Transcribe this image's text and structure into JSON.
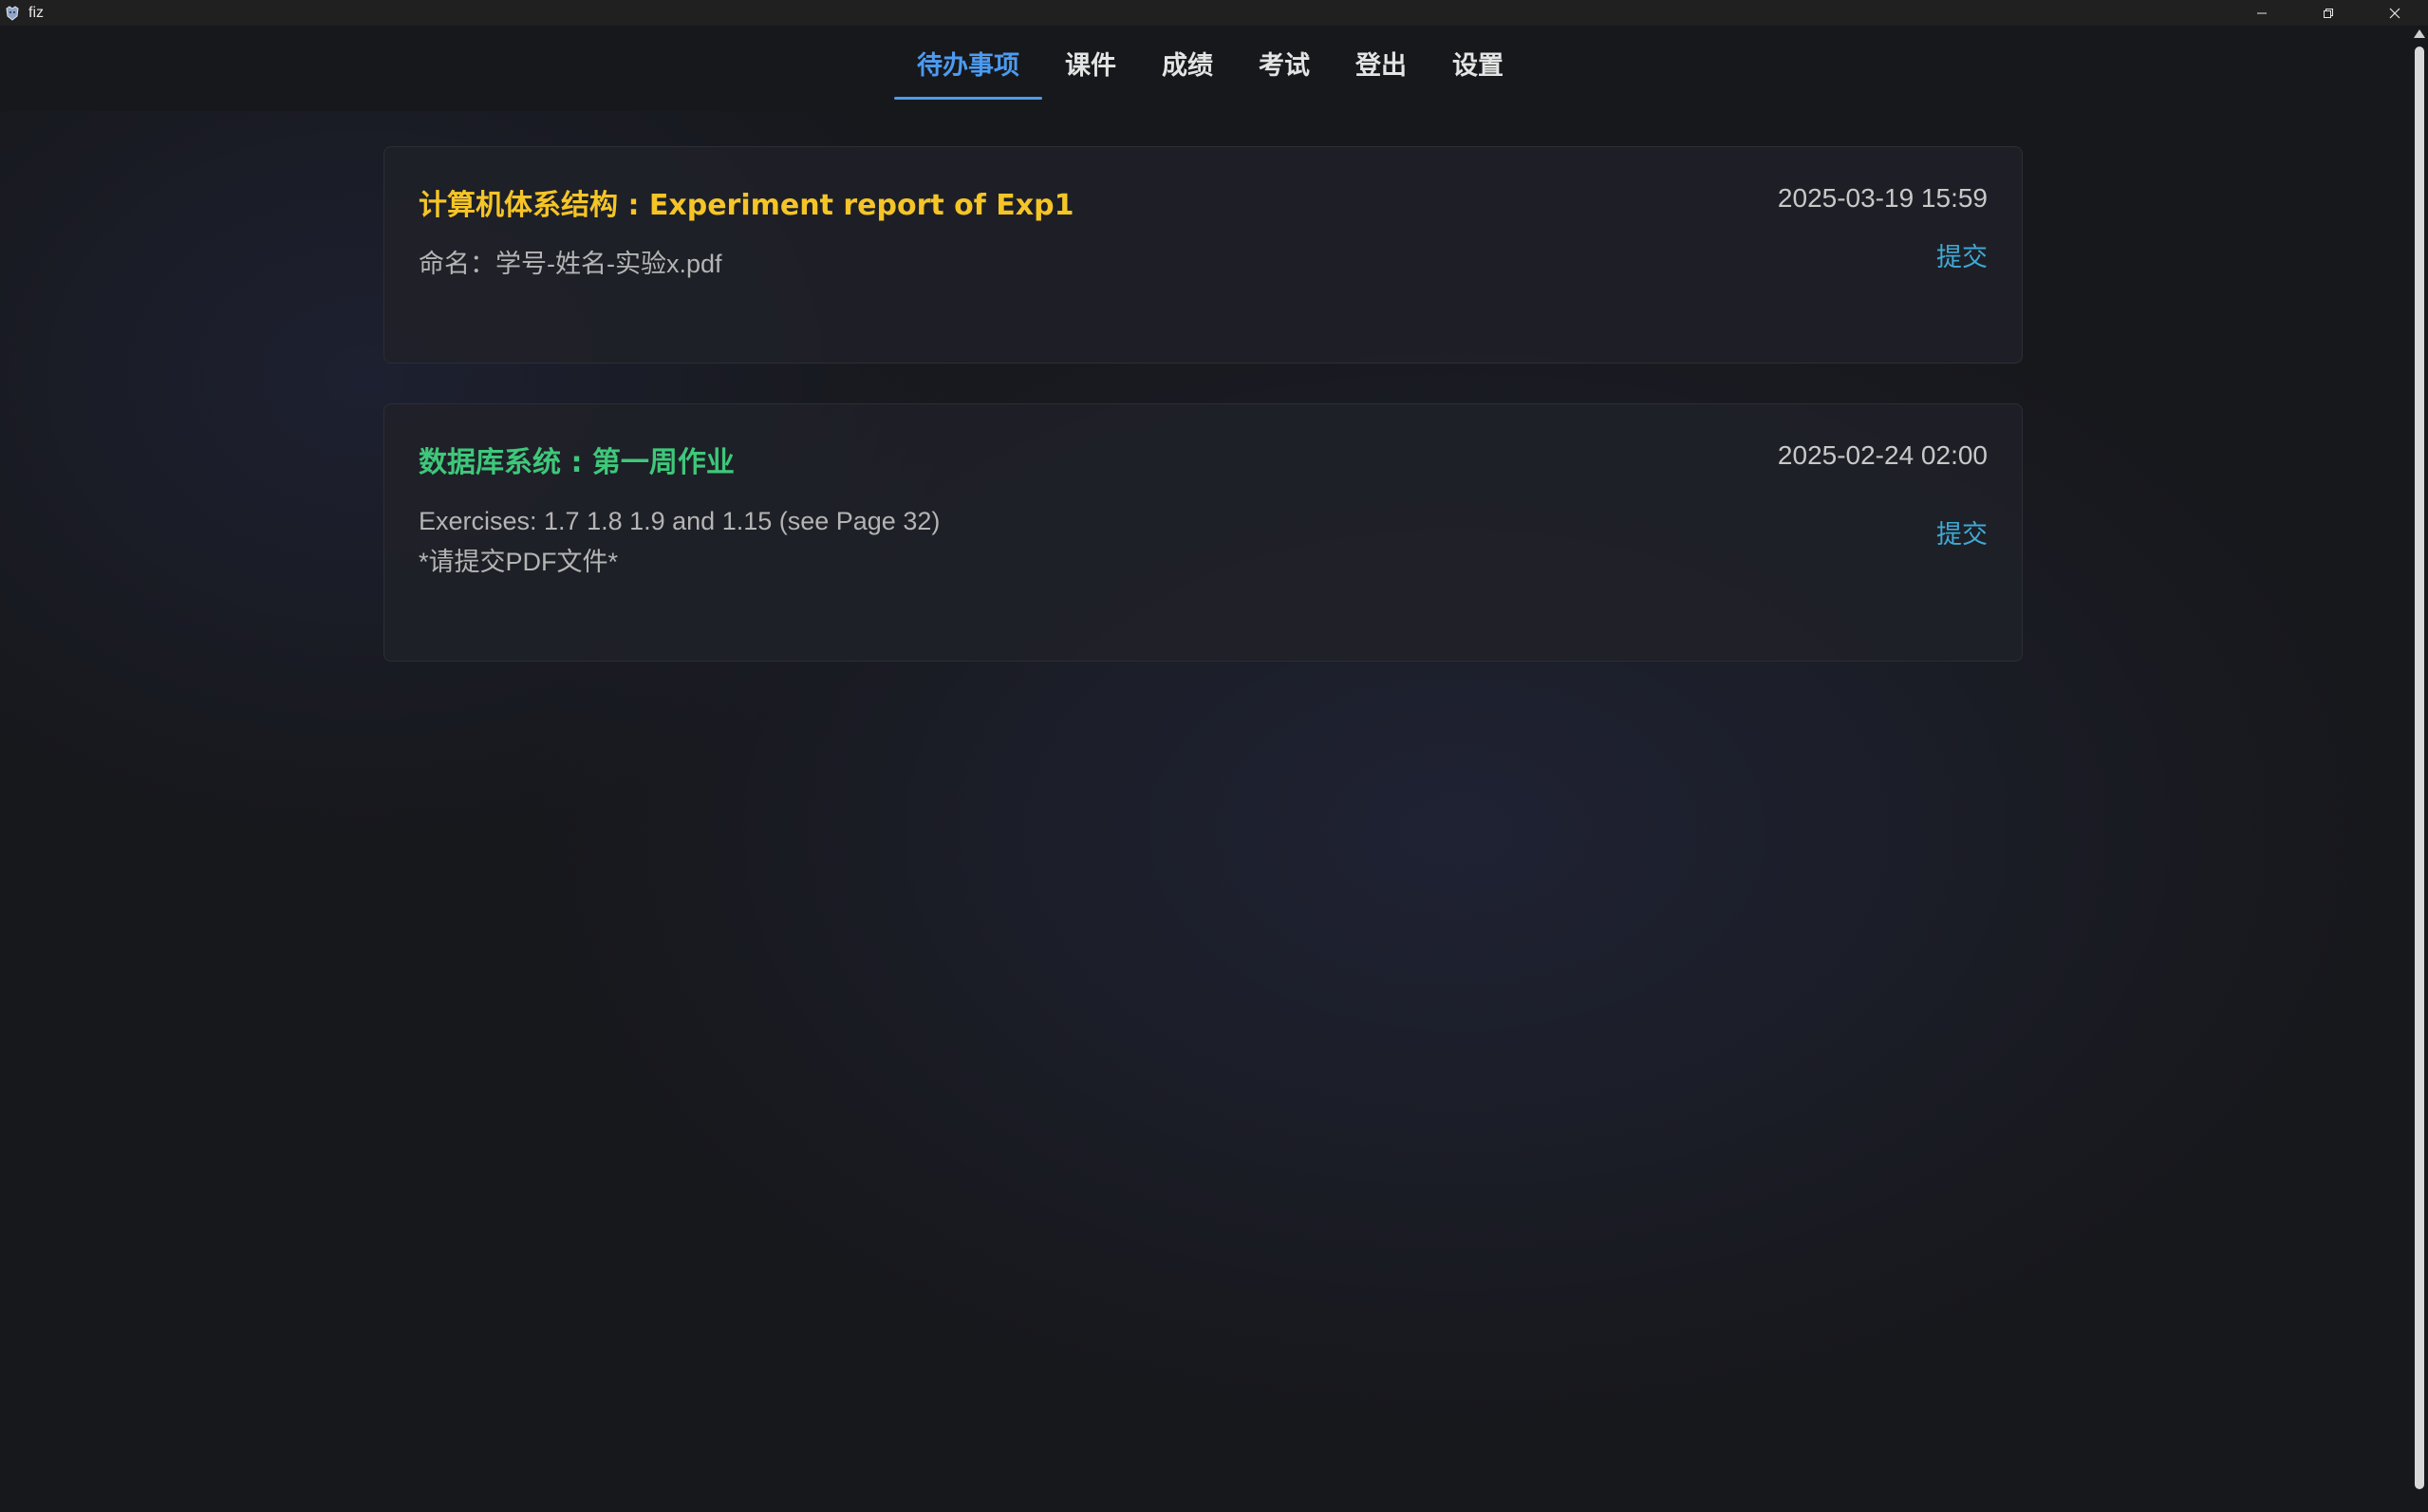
{
  "window": {
    "title": "fiz"
  },
  "nav": {
    "tabs": [
      {
        "label": "待办事项",
        "active": true
      },
      {
        "label": "课件",
        "active": false
      },
      {
        "label": "成绩",
        "active": false
      },
      {
        "label": "考试",
        "active": false
      },
      {
        "label": "登出",
        "active": false
      },
      {
        "label": "设置",
        "active": false
      }
    ]
  },
  "todos": [
    {
      "title": "计算机体系结构 : Experiment report of Exp1",
      "title_color": "#f5c527",
      "date": "2025-03-19 15:59",
      "description": [
        "命名：学号-姓名-实验x.pdf"
      ],
      "action": "提交"
    },
    {
      "title": "数据库系统 : 第一周作业",
      "title_color": "#3ec87a",
      "date": "2025-02-24 02:00",
      "description": [
        "Exercises: 1.7 1.8 1.9 and 1.15 (see Page 32)",
        "*请提交PDF文件*"
      ],
      "action": "提交"
    }
  ],
  "colors": {
    "accent": "#4d9bf0",
    "link": "#3fa9d6"
  }
}
